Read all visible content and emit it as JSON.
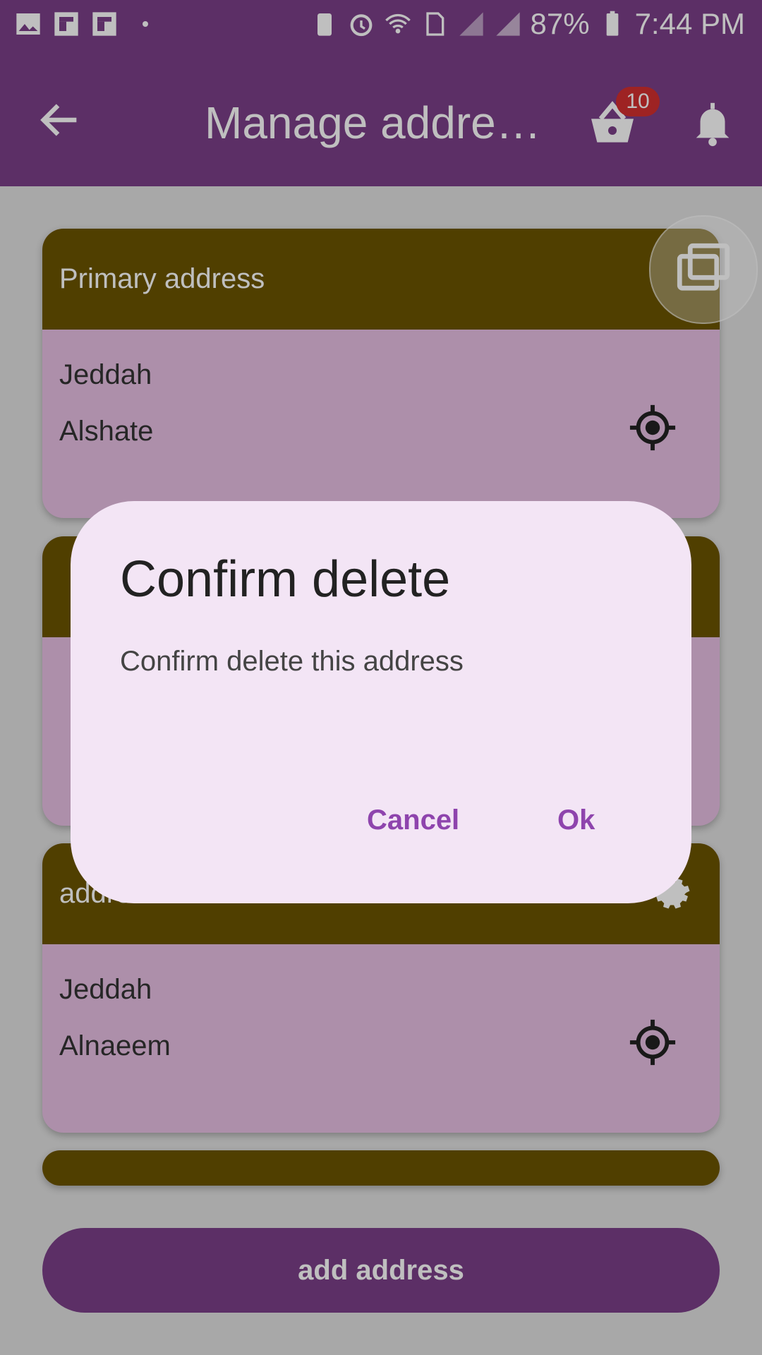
{
  "status_bar": {
    "battery": "87%",
    "time": "7:44 PM"
  },
  "app_bar": {
    "title": "Manage addres…",
    "cart_badge": "10"
  },
  "cards": [
    {
      "header": "Primary address",
      "city": "Jeddah",
      "district": "Alshate"
    },
    {
      "header": "address #2",
      "city": "Jeddah",
      "district": "Alnaeem"
    }
  ],
  "bottom": {
    "add_label": "add address"
  },
  "dialog": {
    "title": "Confirm delete",
    "message": "Confirm delete this address",
    "cancel_label": "Cancel",
    "ok_label": "Ok"
  },
  "colors": {
    "primary": "#7B3F88",
    "card_header": "#6B5400",
    "card_body": "#E7BFE3",
    "dialog_bg": "#F3E5F5",
    "accent": "#8E44AD",
    "badge": "#D32F2F"
  },
  "icons": [
    "image-icon",
    "flipboard-icon",
    "flipboard-icon",
    "battery-saver-icon",
    "alarm-icon",
    "wifi-icon",
    "sim-icon",
    "signal-icon",
    "battery-icon",
    "back-arrow-icon",
    "basket-icon",
    "bell-icon",
    "gear-icon",
    "location-target-icon",
    "multi-window-icon"
  ]
}
